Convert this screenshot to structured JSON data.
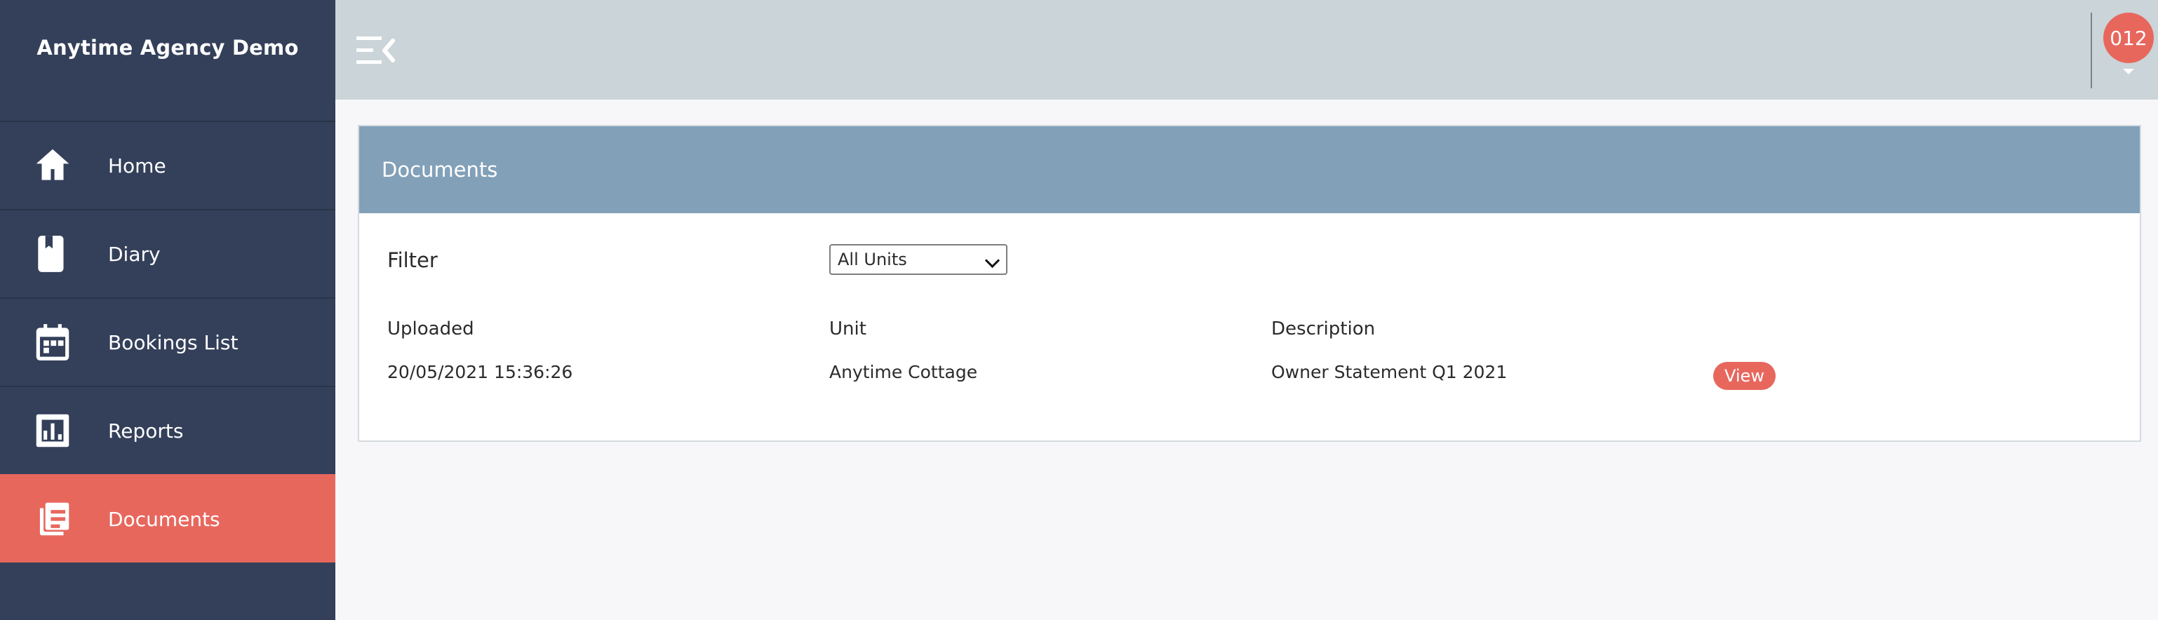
{
  "brand": {
    "title": "Anytime Agency Demo"
  },
  "nav": {
    "items": [
      {
        "label": "Home",
        "icon": "home-icon",
        "active": false
      },
      {
        "label": "Diary",
        "icon": "diary-icon",
        "active": false
      },
      {
        "label": "Bookings List",
        "icon": "calendar-icon",
        "active": false
      },
      {
        "label": "Reports",
        "icon": "reports-icon",
        "active": false
      },
      {
        "label": "Documents",
        "icon": "documents-icon",
        "active": true
      }
    ]
  },
  "header": {
    "user_badge": "012"
  },
  "documents": {
    "title": "Documents",
    "filter": {
      "label": "Filter",
      "selected": "All Units"
    },
    "columns": [
      "Uploaded",
      "Unit",
      "Description"
    ],
    "rows": [
      {
        "uploaded": "20/05/2021 15:36:26",
        "unit": "Anytime Cottage",
        "description": "Owner Statement Q1 2021",
        "action": "View"
      }
    ]
  },
  "colors": {
    "sidebar": "#34405a",
    "accent": "#e8675d",
    "topbar": "#cbd4d8",
    "panel_header": "#82a0b8"
  }
}
